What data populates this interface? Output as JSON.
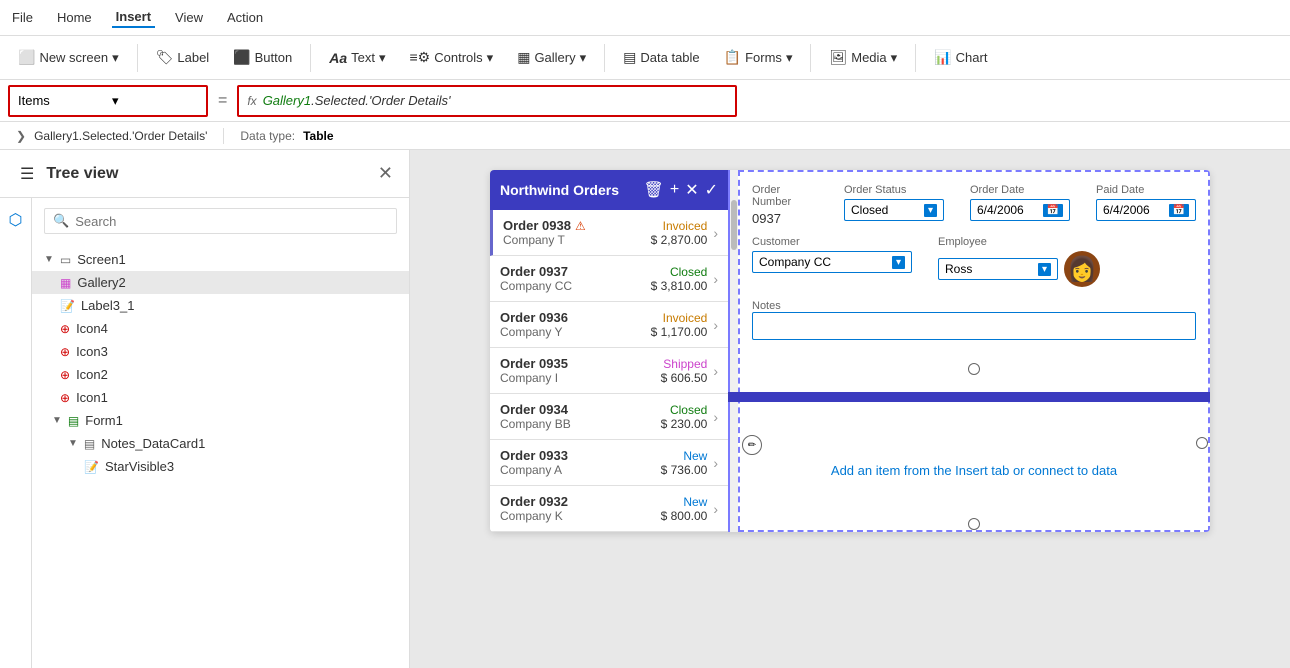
{
  "menuBar": {
    "items": [
      "File",
      "Home",
      "Insert",
      "View",
      "Action"
    ],
    "activeItem": "Insert"
  },
  "toolbar": {
    "buttons": [
      {
        "id": "new-screen",
        "icon": "⬜",
        "label": "New screen",
        "hasDropdown": true
      },
      {
        "id": "label",
        "icon": "🏷",
        "label": "Label",
        "hasDropdown": false
      },
      {
        "id": "button",
        "icon": "⬛",
        "label": "Button",
        "hasDropdown": false
      },
      {
        "id": "text",
        "icon": "T",
        "label": "Text",
        "hasDropdown": true
      },
      {
        "id": "controls",
        "icon": "⚙",
        "label": "Controls",
        "hasDropdown": true
      },
      {
        "id": "gallery",
        "icon": "▦",
        "label": "Gallery",
        "hasDropdown": true
      },
      {
        "id": "data-table",
        "icon": "▤",
        "label": "Data table",
        "hasDropdown": false
      },
      {
        "id": "forms",
        "icon": "📋",
        "label": "Forms",
        "hasDropdown": true
      },
      {
        "id": "media",
        "icon": "🖼",
        "label": "Media",
        "hasDropdown": true
      },
      {
        "id": "chart",
        "icon": "📊",
        "label": "Chart",
        "hasDropdown": false
      }
    ]
  },
  "formulaBar": {
    "property": "Items",
    "equalsSign": "=",
    "fxLabel": "fx",
    "galleryRef": "Gallery1",
    "formulaRest": ".Selected.'Order Details'",
    "suggestion": "Gallery1.Selected.'Order Details'",
    "dataType": "Table"
  },
  "sidebar": {
    "title": "Tree view",
    "searchPlaceholder": "Search",
    "treeItems": [
      {
        "id": "screen1",
        "label": "Screen1",
        "level": 0,
        "hasChildren": true,
        "expanded": true,
        "icon": "screen"
      },
      {
        "id": "gallery2",
        "label": "Gallery2",
        "level": 1,
        "hasChildren": false,
        "expanded": false,
        "icon": "gallery",
        "selected": true
      },
      {
        "id": "label3_1",
        "label": "Label3_1",
        "level": 1,
        "hasChildren": false,
        "icon": "label"
      },
      {
        "id": "icon4",
        "label": "Icon4",
        "level": 1,
        "hasChildren": false,
        "icon": "icon"
      },
      {
        "id": "icon3",
        "label": "Icon3",
        "level": 1,
        "hasChildren": false,
        "icon": "icon"
      },
      {
        "id": "icon2",
        "label": "Icon2",
        "level": 1,
        "hasChildren": false,
        "icon": "icon"
      },
      {
        "id": "icon1",
        "label": "Icon1",
        "level": 1,
        "hasChildren": false,
        "icon": "icon"
      },
      {
        "id": "form1",
        "label": "Form1",
        "level": 1,
        "hasChildren": true,
        "expanded": true,
        "icon": "form"
      },
      {
        "id": "notes_datacard1",
        "label": "Notes_DataCard1",
        "level": 2,
        "hasChildren": true,
        "expanded": true,
        "icon": "datacard"
      },
      {
        "id": "starvisible3",
        "label": "StarVisible3",
        "level": 3,
        "hasChildren": false,
        "icon": "label"
      }
    ]
  },
  "canvas": {
    "headerTitle": "Northwind Orders",
    "galleryItems": [
      {
        "orderId": "Order 0938",
        "company": "Company T",
        "status": "Invoiced",
        "statusType": "invoiced",
        "amount": "$ 2,870.00",
        "hasWarning": true
      },
      {
        "orderId": "Order 0937",
        "company": "Company CC",
        "status": "Closed",
        "statusType": "closed",
        "amount": "$ 3,810.00",
        "hasWarning": false
      },
      {
        "orderId": "Order 0936",
        "company": "Company Y",
        "status": "Invoiced",
        "statusType": "invoiced",
        "amount": "$ 1,170.00",
        "hasWarning": false
      },
      {
        "orderId": "Order 0935",
        "company": "Company I",
        "status": "Shipped",
        "statusType": "shipped",
        "amount": "$ 606.50",
        "hasWarning": false
      },
      {
        "orderId": "Order 0934",
        "company": "Company BB",
        "status": "Closed",
        "statusType": "closed",
        "amount": "$ 230.00",
        "hasWarning": false
      },
      {
        "orderId": "Order 0933",
        "company": "Company A",
        "status": "New",
        "statusType": "new",
        "amount": "$ 736.00",
        "hasWarning": false
      },
      {
        "orderId": "Order 0932",
        "company": "Company K",
        "status": "New",
        "statusType": "new",
        "amount": "$ 800.00",
        "hasWarning": false
      }
    ],
    "form": {
      "orderNumberLabel": "Order Number",
      "orderNumberValue": "0937",
      "orderStatusLabel": "Order Status",
      "orderStatusValue": "Closed",
      "orderDateLabel": "Order Date",
      "orderDateValue": "6/4/2006",
      "paidDateLabel": "Paid Date",
      "paidDateValue": "6/4/2006",
      "customerLabel": "Customer",
      "customerValue": "Company CC",
      "employeeLabel": "Employee",
      "employeeValue": "Ross",
      "notesLabel": "Notes",
      "emptyAreaText": "Add an item from the Insert tab or connect to data"
    }
  }
}
